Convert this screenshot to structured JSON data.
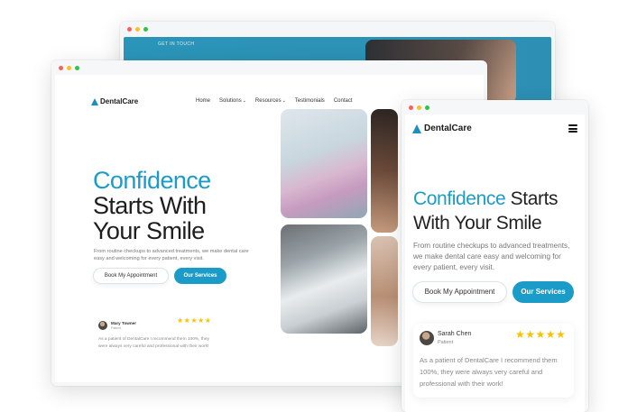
{
  "back_window": {
    "eyebrow": "GET IN TOUCH"
  },
  "desktop": {
    "brand": "DentalCare",
    "nav": [
      {
        "label": "Home"
      },
      {
        "label": "Solutions",
        "chevron": "chevron-down-icon"
      },
      {
        "label": "Resources",
        "chevron": "chevron-down-icon"
      },
      {
        "label": "Testimonials"
      },
      {
        "label": "Contact"
      }
    ],
    "hero": {
      "line1": "Confidence",
      "line2": "Starts With",
      "line3": "Your Smile",
      "description": "From routine checkups to advanced treatments, we make dental care easy and welcoming for every patient, every visit.",
      "primary_button": "Book My Appointment",
      "secondary_button": "Our Services"
    },
    "testimonial": {
      "name": "Mary Towner",
      "role": "Patient",
      "stars": "★★★★★",
      "rating": 5,
      "text": "As a patient of DentalCare I recommend them 100%, they were always very careful and professional with their work!"
    }
  },
  "mobile": {
    "brand": "DentalCare",
    "menu_icon": "hamburger-menu-icon",
    "hero": {
      "accent": "Confidence",
      "rest": " Starts With Your Smile",
      "description": "From routine checkups to advanced treatments, we make dental care easy and welcoming for every patient, every visit.",
      "primary_button": "Book My Appointment",
      "secondary_button": "Our Services"
    },
    "testimonial": {
      "name": "Sarah Chen",
      "role": "Patient",
      "stars": "★★★★★",
      "rating": 5,
      "text": "As a patient of DentalCare I recommend them 100%, they were always very careful and professional with their work!"
    }
  },
  "colors": {
    "accent": "#1b9cc8",
    "star": "#f7c300",
    "text": "#1e1e1e"
  }
}
